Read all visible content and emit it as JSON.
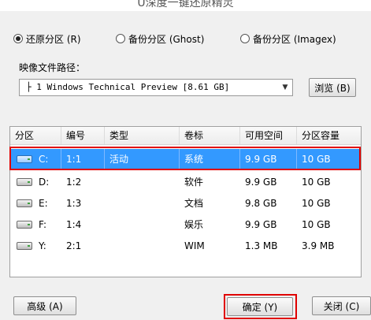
{
  "window": {
    "title": "U深度一键还原精灵"
  },
  "mode_options": [
    {
      "label": "还原分区 (R)",
      "selected": true
    },
    {
      "label": "备份分区 (Ghost)",
      "selected": false
    },
    {
      "label": "备份分区 (Imagex)",
      "selected": false
    }
  ],
  "image_path": {
    "label": "映像文件路径：",
    "selected_value": "├ 1 Windows Technical Preview [8.61 GB]",
    "browse_label": "浏览 (B)"
  },
  "table": {
    "columns": [
      "分区",
      "编号",
      "类型",
      "卷标",
      "可用空间",
      "分区容量"
    ],
    "rows": [
      {
        "drive": "C:",
        "num": "1:1",
        "type": "活动",
        "label": "系统",
        "free": "9.9 GB",
        "size": "10 GB",
        "selected": true
      },
      {
        "drive": "D:",
        "num": "1:2",
        "type": "",
        "label": "软件",
        "free": "9.9 GB",
        "size": "10 GB",
        "selected": false
      },
      {
        "drive": "E:",
        "num": "1:3",
        "type": "",
        "label": "文档",
        "free": "9.8 GB",
        "size": "10 GB",
        "selected": false
      },
      {
        "drive": "F:",
        "num": "1:4",
        "type": "",
        "label": "娱乐",
        "free": "9.9 GB",
        "size": "10 GB",
        "selected": false
      },
      {
        "drive": "Y:",
        "num": "2:1",
        "type": "",
        "label": "WIM",
        "free": "1.3 MB",
        "size": "3.9 MB",
        "selected": false
      }
    ]
  },
  "buttons": {
    "advanced": "高级 (A)",
    "confirm": "确定 (Y)",
    "close": "关闭 (C)"
  },
  "icons": {
    "dropdown": "chevron-down-icon",
    "drive": "hard-drive-icon"
  },
  "colors": {
    "selection": "#3399ff",
    "highlight": "#e00000"
  }
}
